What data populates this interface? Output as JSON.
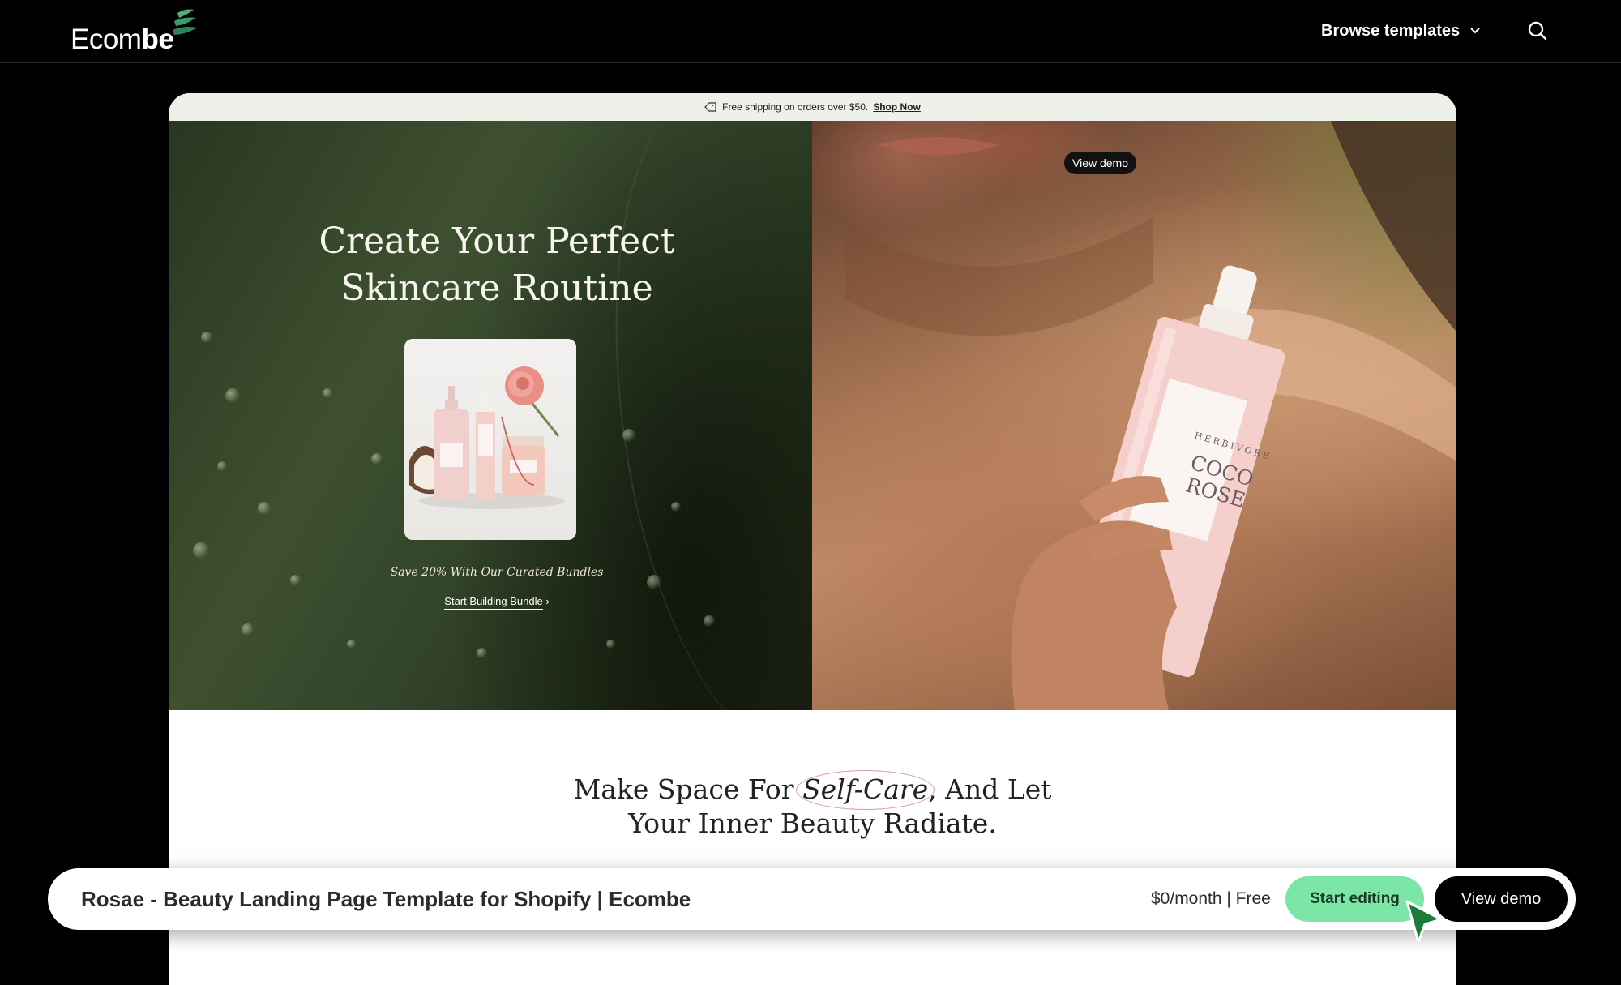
{
  "nav": {
    "logo_regular": "Ecom",
    "logo_bold": "be",
    "browse_label": "Browse templates",
    "icons": [
      "leaf-logo-icon",
      "chevron-down-icon",
      "search-icon"
    ]
  },
  "preview": {
    "announcement": {
      "text": "Free shipping on orders over $50.",
      "link": "Shop Now",
      "icon": "tag-icon"
    },
    "hero": {
      "title": "Create Your Perfect Skincare Routine",
      "subtitle": "Save 20% With Our Curated Bundles",
      "cta": "Start Building Bundle",
      "cta_icon": "chevron-right-icon",
      "bottle_brand": "HERBIVORE",
      "bottle_name_line1": "COCO",
      "bottle_name_line2": "ROSE"
    },
    "view_demo_chip": "View demo",
    "section": {
      "title_before": "Make Space For ",
      "title_emphasis": "Self-Care",
      "title_after": ", And Let",
      "title_line2": "Your Inner Beauty Radiate."
    }
  },
  "footer_bar": {
    "title": "Rosae - Beauty Landing Page Template for Shopify | Ecombe",
    "price": "$0/month | Free",
    "start_editing": "Start editing",
    "view_demo": "View demo"
  },
  "colors": {
    "accent_green": "#7be6a6",
    "cursor_green": "#1f7a3a",
    "logo_green": "#4fae7c"
  }
}
